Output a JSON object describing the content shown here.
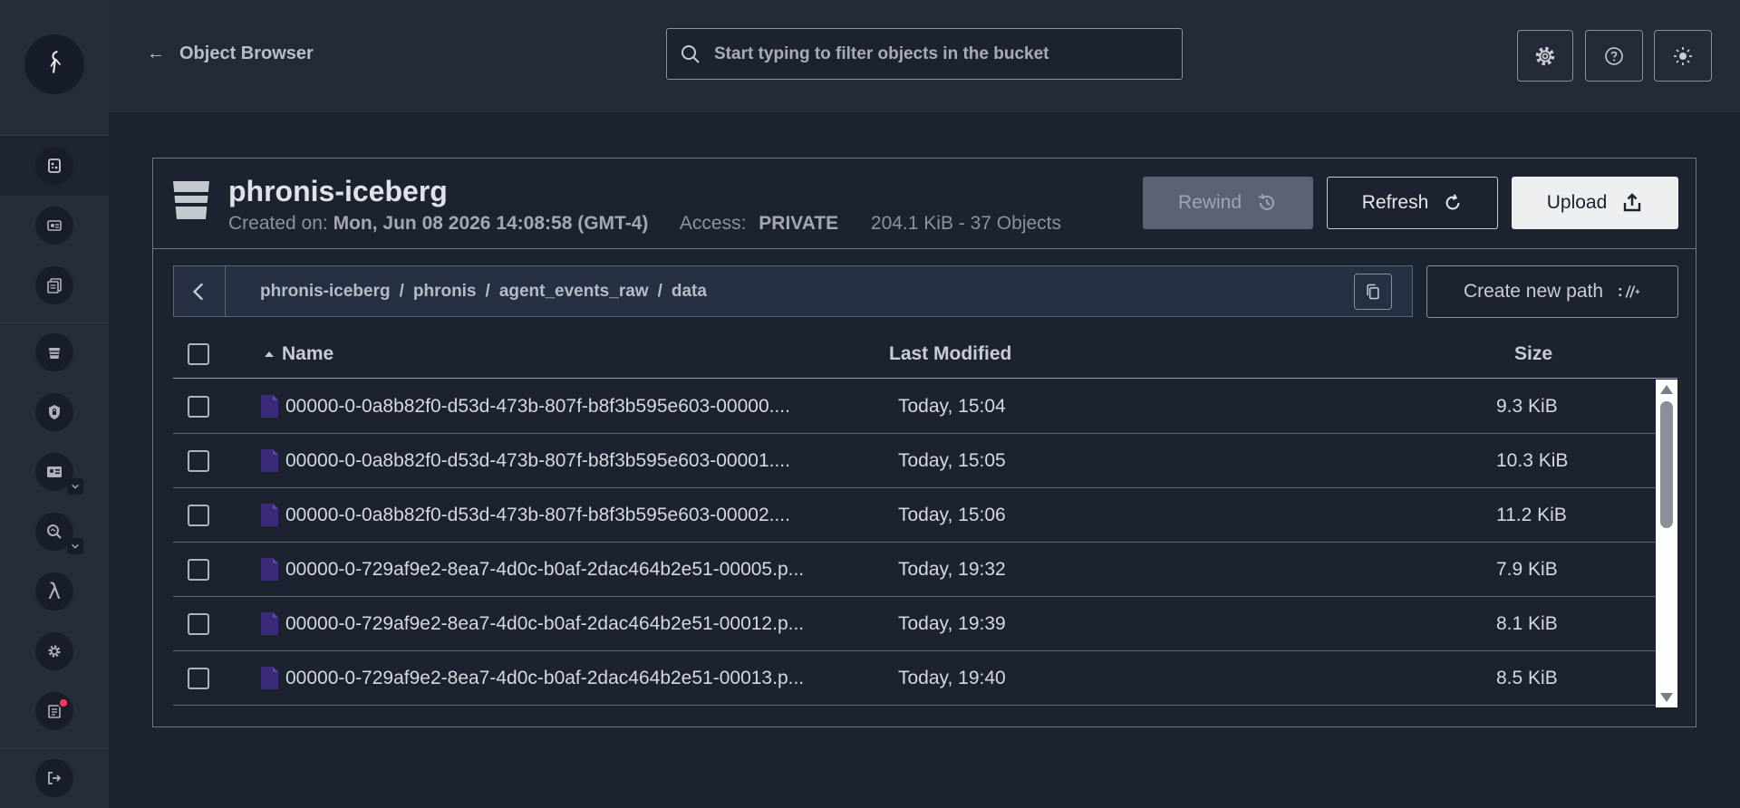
{
  "header": {
    "back_label": "Object Browser",
    "search_placeholder": "Start typing to filter objects in the bucket",
    "icons": [
      "gear-icon",
      "help-icon",
      "sun-icon"
    ]
  },
  "sidebar": {
    "items": [
      {
        "name": "object-browser",
        "icon": "object-browser-icon",
        "active": true
      },
      {
        "name": "access-keys",
        "icon": "id-card-icon"
      },
      {
        "name": "documentation",
        "icon": "documents-icon"
      },
      {
        "name": "buckets",
        "icon": "bucket-icon"
      },
      {
        "name": "policies",
        "icon": "shield-icon"
      },
      {
        "name": "identity",
        "icon": "identity-icon",
        "expandable": true
      },
      {
        "name": "monitoring",
        "icon": "magnifier-icon",
        "expandable": true
      },
      {
        "name": "events",
        "icon": "lambda-icon"
      },
      {
        "name": "settings",
        "icon": "gear-icon"
      },
      {
        "name": "license",
        "icon": "license-icon",
        "badge": true
      },
      {
        "name": "logout",
        "icon": "logout-icon"
      }
    ]
  },
  "bucket": {
    "name": "phronis-iceberg",
    "created_label": "Created on:",
    "created_value": "Mon, Jun 08 2026 14:08:58 (GMT-4)",
    "access_label": "Access:",
    "access_value": "PRIVATE",
    "usage": "204.1 KiB - 37 Objects"
  },
  "actions": {
    "rewind": "Rewind",
    "refresh": "Refresh",
    "upload": "Upload",
    "create_path": "Create new path"
  },
  "breadcrumb": [
    "phronis-iceberg",
    "phronis",
    "agent_events_raw",
    "data"
  ],
  "table": {
    "columns": {
      "name": "Name",
      "modified": "Last Modified",
      "size": "Size"
    },
    "rows": [
      {
        "name": "00000-0-0a8b82f0-d53d-473b-807f-b8f3b595e603-00000....",
        "modified": "Today, 15:04",
        "size": "9.3 KiB"
      },
      {
        "name": "00000-0-0a8b82f0-d53d-473b-807f-b8f3b595e603-00001....",
        "modified": "Today, 15:05",
        "size": "10.3 KiB"
      },
      {
        "name": "00000-0-0a8b82f0-d53d-473b-807f-b8f3b595e603-00002....",
        "modified": "Today, 15:06",
        "size": "11.2 KiB"
      },
      {
        "name": "00000-0-729af9e2-8ea7-4d0c-b0af-2dac464b2e51-00005.p...",
        "modified": "Today, 19:32",
        "size": "7.9 KiB"
      },
      {
        "name": "00000-0-729af9e2-8ea7-4d0c-b0af-2dac464b2e51-00012.p...",
        "modified": "Today, 19:39",
        "size": "8.1 KiB"
      },
      {
        "name": "00000-0-729af9e2-8ea7-4d0c-b0af-2dac464b2e51-00013.p...",
        "modified": "Today, 19:40",
        "size": "8.5 KiB"
      }
    ]
  },
  "colors": {
    "background": "#1c2230",
    "sidebar": "#252d3b",
    "file_icon": "#3b2a7a",
    "badge": "#ff3858"
  }
}
